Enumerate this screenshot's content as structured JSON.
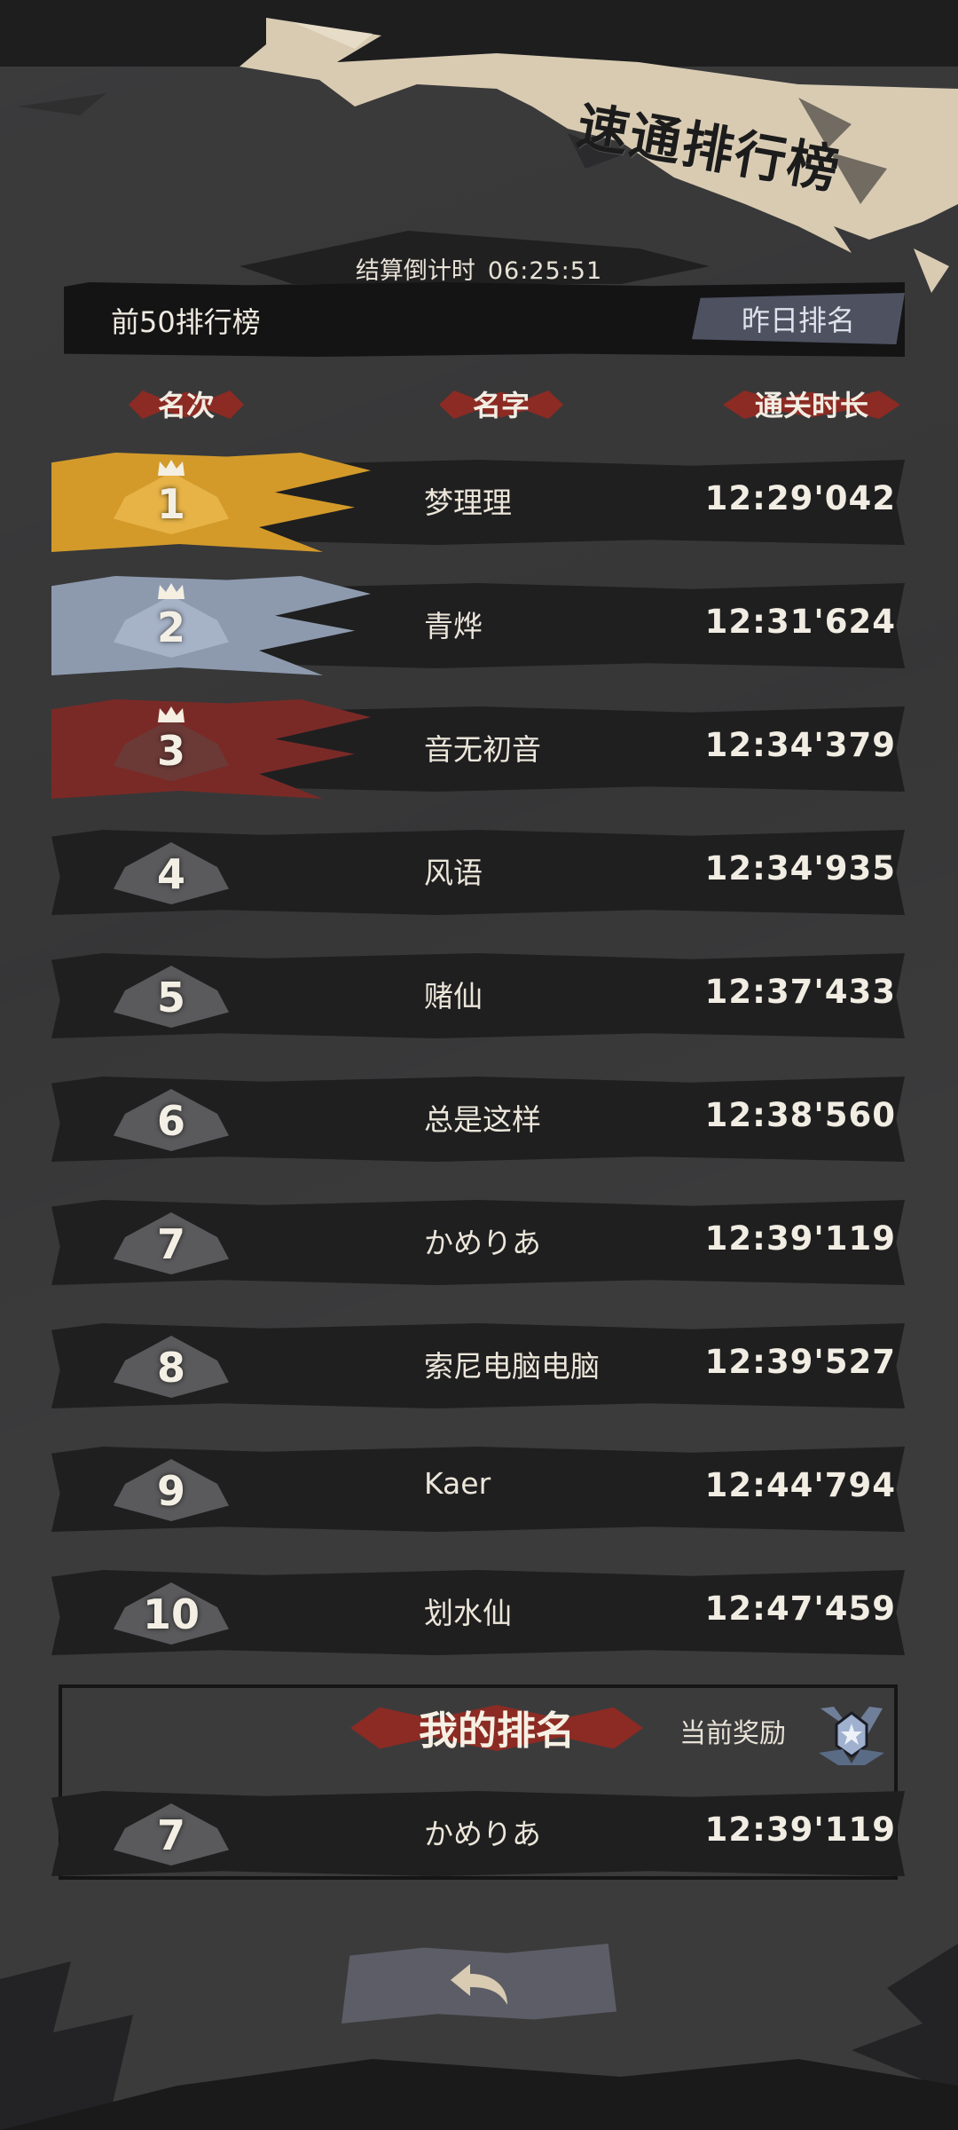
{
  "header": {
    "title": "速通排行榜",
    "countdown_label": "结算倒计时",
    "countdown_value": "06:25:51"
  },
  "board": {
    "title": "前50排行榜",
    "yesterday_button": "昨日排名"
  },
  "columns": {
    "rank": "名次",
    "name": "名字",
    "time": "通关时长"
  },
  "rows": [
    {
      "rank": "1",
      "name": "梦理理",
      "time": "12:29'042",
      "tier": "gold"
    },
    {
      "rank": "2",
      "name": "青烨",
      "time": "12:31'624",
      "tier": "silver"
    },
    {
      "rank": "3",
      "name": "音无初音",
      "time": "12:34'379",
      "tier": "bronze"
    },
    {
      "rank": "4",
      "name": "风语",
      "time": "12:34'935",
      "tier": "normal"
    },
    {
      "rank": "5",
      "name": "赌仙",
      "time": "12:37'433",
      "tier": "normal"
    },
    {
      "rank": "6",
      "name": "总是这样",
      "time": "12:38'560",
      "tier": "normal"
    },
    {
      "rank": "7",
      "name": "かめりあ",
      "time": "12:39'119",
      "tier": "normal"
    },
    {
      "rank": "8",
      "name": "索尼电脑电脑",
      "time": "12:39'527",
      "tier": "normal"
    },
    {
      "rank": "9",
      "name": "Kaer",
      "time": "12:44'794",
      "tier": "normal"
    },
    {
      "rank": "10",
      "name": "划水仙",
      "time": "12:47'459",
      "tier": "normal"
    }
  ],
  "my_rank": {
    "title": "我的排名",
    "reward_label": "当前奖励",
    "reward_icon": "medal-icon",
    "rank": "7",
    "name": "かめりあ",
    "time": "12:39'119"
  },
  "back_icon": "back-arrow-icon",
  "colors": {
    "gold": "#d39a2a",
    "silver": "#8d9aae",
    "bronze": "#7a2a26",
    "accent_red": "#8b2b23",
    "title_paper": "#d8cbb2"
  }
}
